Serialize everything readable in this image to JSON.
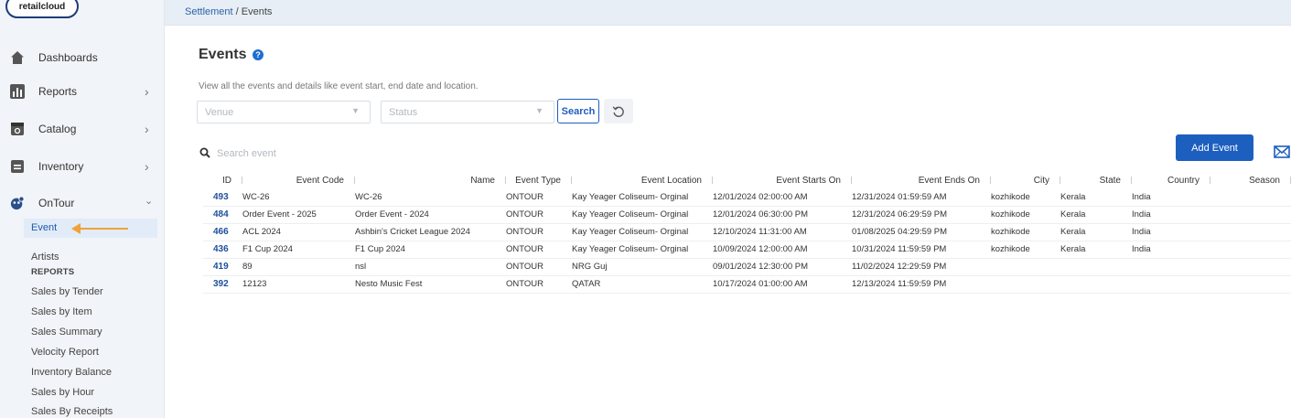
{
  "logo": "retailcloud",
  "sidebar": {
    "items": [
      {
        "label": "Dashboards",
        "icon": "home-icon"
      },
      {
        "label": "Reports",
        "icon": "bar-chart-icon",
        "chevron": "›"
      },
      {
        "label": "Catalog",
        "icon": "catalog-icon",
        "chevron": "›"
      },
      {
        "label": "Inventory",
        "icon": "inventory-icon",
        "chevron": "›"
      },
      {
        "label": "OnTour",
        "icon": "ontour-icon",
        "chevron": "⌄"
      }
    ],
    "ontour": {
      "active": "Event",
      "artists": "Artists",
      "reports_heading": "REPORTS",
      "reports": [
        "Sales by Tender",
        "Sales by Item",
        "Sales Summary",
        "Velocity Report",
        "Inventory Balance",
        "Sales by Hour",
        "Sales By Receipts"
      ]
    }
  },
  "breadcrumb": {
    "parent": "Settlement",
    "separator": "/",
    "current": "Events"
  },
  "page": {
    "title": "Events",
    "description": "View all the events and details like event start, end date and location."
  },
  "filters": {
    "venue_placeholder": "Venue",
    "status_placeholder": "Status",
    "search_label": "Search"
  },
  "search": {
    "placeholder": "Search event"
  },
  "add_event_label": "Add Event",
  "table": {
    "columns": [
      "ID",
      "Event Code",
      "Name",
      "Event Type",
      "Event Location",
      "Event Starts On",
      "Event Ends On",
      "City",
      "State",
      "Country",
      "Season"
    ],
    "rows": [
      [
        "493",
        "WC-26",
        "WC-26",
        "ONTOUR",
        "Kay Yeager Coliseum- Orginal",
        "12/01/2024 02:00:00 AM",
        "12/31/2024 01:59:59 AM",
        "kozhikode",
        "Kerala",
        "India",
        ""
      ],
      [
        "484",
        "Order Event - 2025",
        "Order Event - 2024",
        "ONTOUR",
        "Kay Yeager Coliseum- Orginal",
        "12/01/2024 06:30:00 PM",
        "12/31/2024 06:29:59 PM",
        "kozhikode",
        "Kerala",
        "India",
        ""
      ],
      [
        "466",
        "ACL 2024",
        "Ashbin's Cricket League 2024",
        "ONTOUR",
        "Kay Yeager Coliseum- Orginal",
        "12/10/2024 11:31:00 AM",
        "01/08/2025 04:29:59 PM",
        "kozhikode",
        "Kerala",
        "India",
        ""
      ],
      [
        "436",
        "F1 Cup 2024",
        "F1 Cup 2024",
        "ONTOUR",
        "Kay Yeager Coliseum- Orginal",
        "10/09/2024 12:00:00 AM",
        "10/31/2024 11:59:59 PM",
        "kozhikode",
        "Kerala",
        "India",
        ""
      ],
      [
        "419",
        "89",
        "nsl",
        "ONTOUR",
        "NRG Guj",
        "09/01/2024 12:30:00 PM",
        "11/02/2024 12:29:59 PM",
        "",
        "",
        "",
        ""
      ],
      [
        "392",
        "12123",
        "Nesto Music Fest",
        "ONTOUR",
        "QATAR",
        "10/17/2024 01:00:00 AM",
        "12/13/2024 11:59:59 PM",
        "",
        "",
        "",
        ""
      ]
    ]
  },
  "colors": {
    "primary": "#1d5fbf",
    "sidebar_bg": "#f1f4f8",
    "arrow": "#f0a23a"
  }
}
